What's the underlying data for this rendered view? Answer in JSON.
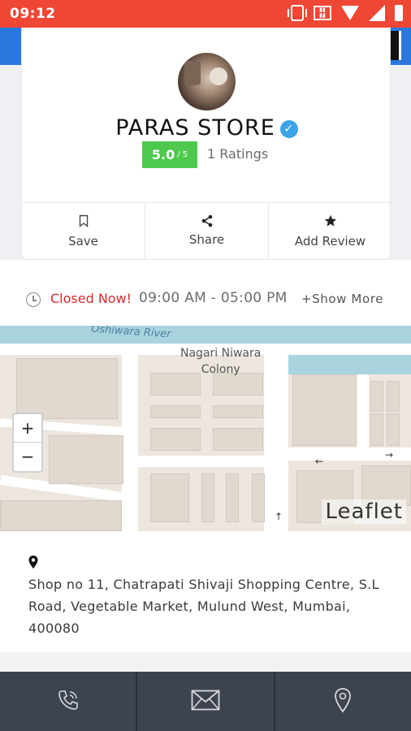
{
  "status_bar": {
    "time": "09:12"
  },
  "store": {
    "name": "PARAS STORE",
    "rating_value": "5.0",
    "rating_denominator": "/ 5",
    "ratings_count": "1 Ratings"
  },
  "actions": [
    {
      "label": "Save",
      "icon": "bookmark-icon"
    },
    {
      "label": "Share",
      "icon": "share-icon"
    },
    {
      "label": "Add Review",
      "icon": "star-icon"
    }
  ],
  "hours": {
    "status": "Closed Now!",
    "range": "09:00 AM - 05:00 PM",
    "show_more": "+Show More"
  },
  "map": {
    "river_label": "Oshiwara River",
    "place_label_1": "Nagari Niwara",
    "place_label_2": "Colony",
    "zoom_in": "+",
    "zoom_out": "−",
    "attribution": "Leaflet"
  },
  "address": {
    "text": "Shop no 11, Chatrapati Shivaji Shopping Centre, S.L Road, Vegetable Market, Mulund West, Mumbai, 400080"
  },
  "bottom_bar": [
    {
      "icon": "phone-icon"
    },
    {
      "icon": "mail-icon"
    },
    {
      "icon": "location-icon"
    }
  ],
  "colors": {
    "status_bar": "#ef4735",
    "rating_badge": "#4ec94e",
    "closed_text": "#d52b2b",
    "bottom_bar": "#3d4450",
    "verified": "#3ba3e6"
  }
}
